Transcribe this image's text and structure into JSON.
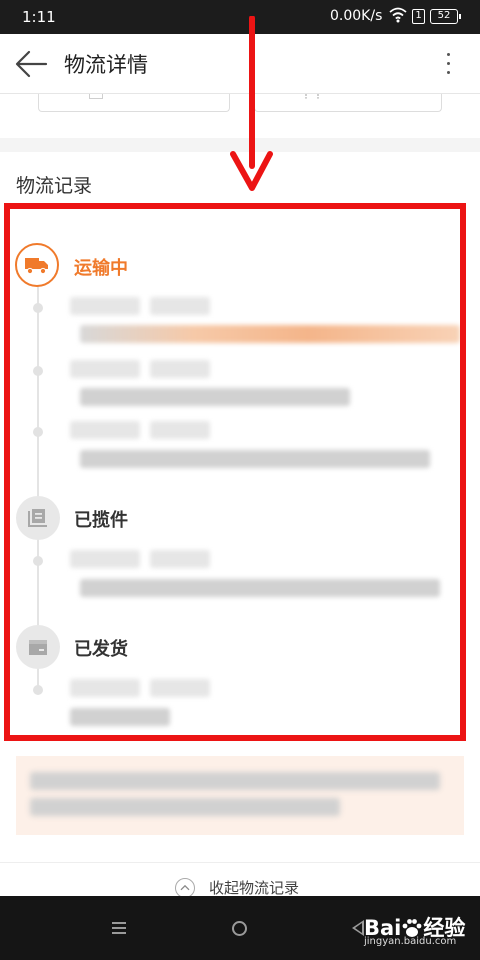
{
  "status_bar": {
    "time": "1:11",
    "network_speed": "0.00K/s",
    "sim_label": "1",
    "battery": "52"
  },
  "header": {
    "title": "物流详情"
  },
  "logistics": {
    "section_title": "物流记录",
    "nodes": [
      {
        "label": "运输中",
        "icon": "truck-icon",
        "state": "active"
      },
      {
        "label": "已揽件",
        "icon": "package-icon",
        "state": "inactive"
      },
      {
        "label": "已发货",
        "icon": "box-icon",
        "state": "inactive"
      }
    ]
  },
  "footer": {
    "collapse_label": "收起物流记录"
  },
  "watermark": {
    "logo_text_1": "Bai",
    "logo_text_2": "经验",
    "url": "jingyan.baidu.com"
  },
  "colors": {
    "accent": "#f07a2b",
    "annotation": "#ec1414",
    "notice_bg": "#fdf0e8"
  }
}
